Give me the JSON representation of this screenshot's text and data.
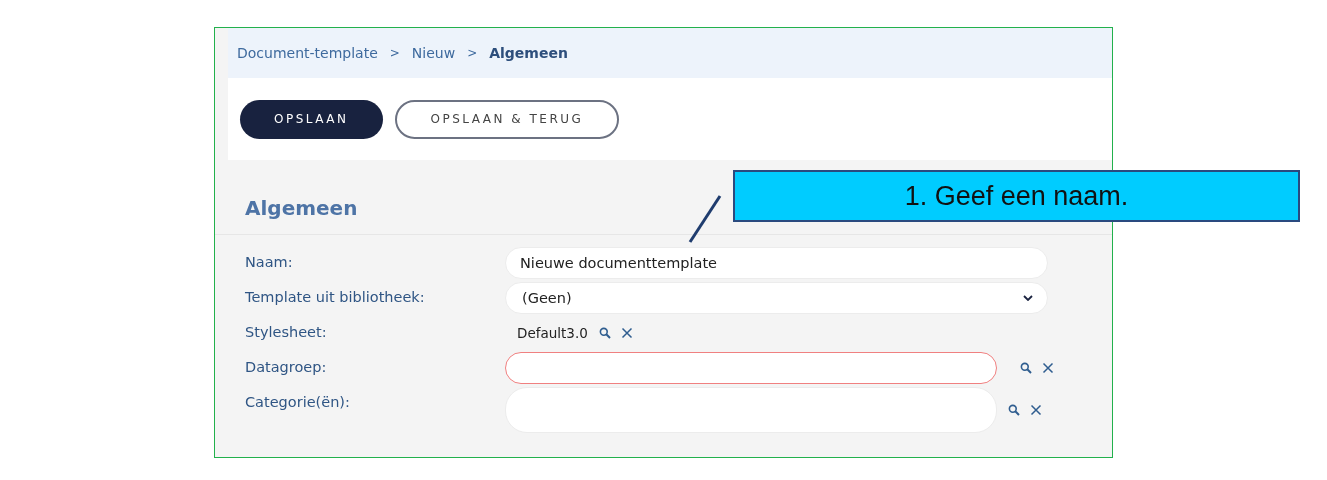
{
  "breadcrumb": [
    {
      "label": "Document-template",
      "current": false
    },
    {
      "label": "Nieuw",
      "current": false
    },
    {
      "label": "Algemeen",
      "current": true
    }
  ],
  "separator": ">",
  "buttons": [
    {
      "label": "OPSLAAN",
      "kind": "primary"
    },
    {
      "label": "OPSLAAN & TERUG",
      "kind": "outline"
    }
  ],
  "section": {
    "title": "Algemeen"
  },
  "fields": [
    {
      "label": "Naam:",
      "kind": "text",
      "value": "Nieuwe documenttemplate"
    },
    {
      "label": "Template uit bibliotheek:",
      "kind": "select",
      "value": "(Geen)"
    },
    {
      "label": "Stylesheet:",
      "kind": "lookup-value",
      "value": "Default3.0"
    },
    {
      "label": "Datagroep:",
      "kind": "lookup-field",
      "invalid": true
    },
    {
      "label": "Categorie(ën):",
      "kind": "lookup-area"
    }
  ],
  "callout": {
    "text": "1. Geef een naam."
  }
}
